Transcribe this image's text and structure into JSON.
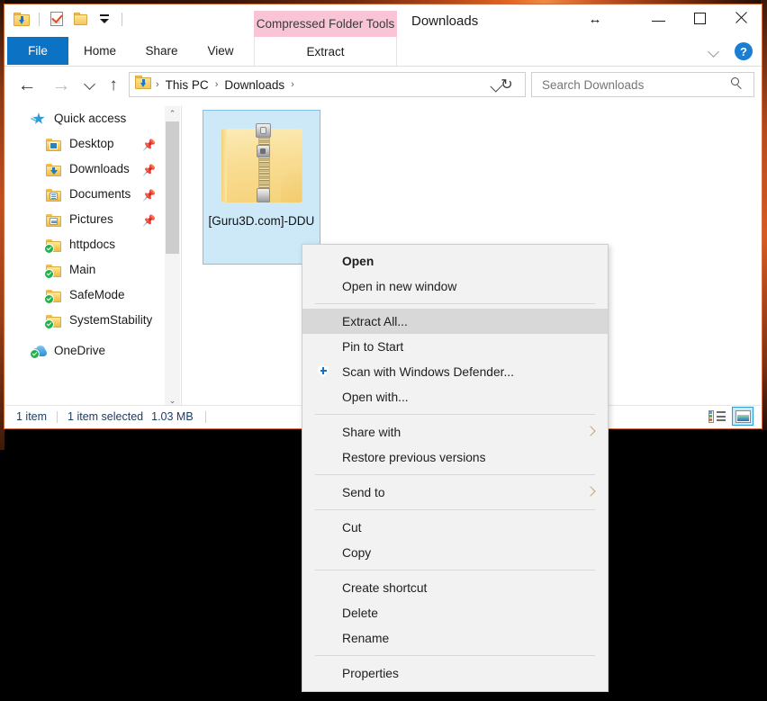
{
  "window": {
    "title": "Downloads",
    "contextual_tab_header": "Compressed Folder Tools",
    "resize_cursor_glyph": "↔",
    "controls": {
      "minimize": "minimize-button",
      "maximize": "maximize-button",
      "close": "close-button",
      "help": "?"
    }
  },
  "quick_access_toolbar": {
    "items": [
      {
        "icon": "downloads-folder-icon"
      },
      {
        "icon": "properties-checkmark-icon"
      },
      {
        "icon": "new-folder-icon"
      },
      {
        "icon": "customize-dropdown-icon"
      }
    ]
  },
  "ribbon": {
    "tabs": [
      {
        "label": "File",
        "selected": true
      },
      {
        "label": "Home",
        "selected": false
      },
      {
        "label": "Share",
        "selected": false
      },
      {
        "label": "View",
        "selected": false
      }
    ],
    "contextual_tab": {
      "label": "Extract",
      "selected": false
    }
  },
  "addressbar": {
    "back_glyph": "←",
    "forward_glyph": "→",
    "up_glyph": "↑",
    "refresh_glyph": "↻",
    "breadcrumb": [
      "This PC",
      "Downloads"
    ],
    "separator": "›"
  },
  "search": {
    "placeholder": "Search Downloads",
    "value": ""
  },
  "navigation_pane": {
    "items": [
      {
        "label": "Quick access",
        "icon": "star-icon",
        "level": "root",
        "pinned": false
      },
      {
        "label": "Desktop",
        "icon": "desktop-folder-icon",
        "level": "child",
        "pinned": true
      },
      {
        "label": "Downloads",
        "icon": "downloads-folder-icon",
        "level": "child",
        "pinned": true
      },
      {
        "label": "Documents",
        "icon": "documents-folder-icon",
        "level": "child",
        "pinned": true
      },
      {
        "label": "Pictures",
        "icon": "pictures-folder-icon",
        "level": "child",
        "pinned": true
      },
      {
        "label": "httpdocs",
        "icon": "synced-folder-icon",
        "level": "child",
        "pinned": false
      },
      {
        "label": "Main",
        "icon": "synced-folder-icon",
        "level": "child",
        "pinned": false
      },
      {
        "label": "SafeMode",
        "icon": "synced-folder-icon",
        "level": "child",
        "pinned": false
      },
      {
        "label": "SystemStability",
        "icon": "synced-folder-icon",
        "level": "child",
        "pinned": false
      },
      {
        "label": "OneDrive",
        "icon": "onedrive-cloud-icon",
        "level": "root",
        "pinned": false
      }
    ],
    "scroll_up_glyph": "⌃",
    "scroll_down_glyph": "⌄"
  },
  "files": [
    {
      "name": "[Guru3D.com]-DDU",
      "icon": "zip-folder-icon",
      "selected": true
    }
  ],
  "statusbar": {
    "item_count": "1 item",
    "selection": "1 item selected",
    "size": "1.03 MB",
    "views": [
      {
        "name": "details-view",
        "selected": false
      },
      {
        "name": "large-icons-view",
        "selected": true
      }
    ]
  },
  "context_menu": {
    "groups": [
      {
        "items": [
          {
            "label": "Open",
            "bold": true,
            "highlighted": false,
            "icon": null,
            "submenu": false
          },
          {
            "label": "Open in new window",
            "bold": false,
            "highlighted": false,
            "icon": null,
            "submenu": false
          }
        ]
      },
      {
        "items": [
          {
            "label": "Extract All...",
            "bold": false,
            "highlighted": true,
            "icon": null,
            "submenu": false
          },
          {
            "label": "Pin to Start",
            "bold": false,
            "highlighted": false,
            "icon": null,
            "submenu": false
          },
          {
            "label": "Scan with Windows Defender...",
            "bold": false,
            "highlighted": false,
            "icon": "defender-shield-icon",
            "submenu": false
          },
          {
            "label": "Open with...",
            "bold": false,
            "highlighted": false,
            "icon": null,
            "submenu": false
          }
        ]
      },
      {
        "items": [
          {
            "label": "Share with",
            "bold": false,
            "highlighted": false,
            "icon": null,
            "submenu": true
          },
          {
            "label": "Restore previous versions",
            "bold": false,
            "highlighted": false,
            "icon": null,
            "submenu": false
          }
        ]
      },
      {
        "items": [
          {
            "label": "Send to",
            "bold": false,
            "highlighted": false,
            "icon": null,
            "submenu": true
          }
        ]
      },
      {
        "items": [
          {
            "label": "Cut",
            "bold": false,
            "highlighted": false,
            "icon": null,
            "submenu": false
          },
          {
            "label": "Copy",
            "bold": false,
            "highlighted": false,
            "icon": null,
            "submenu": false
          }
        ]
      },
      {
        "items": [
          {
            "label": "Create shortcut",
            "bold": false,
            "highlighted": false,
            "icon": null,
            "submenu": false
          },
          {
            "label": "Delete",
            "bold": false,
            "highlighted": false,
            "icon": null,
            "submenu": false
          },
          {
            "label": "Rename",
            "bold": false,
            "highlighted": false,
            "icon": null,
            "submenu": false
          }
        ]
      },
      {
        "items": [
          {
            "label": "Properties",
            "bold": false,
            "highlighted": false,
            "icon": null,
            "submenu": false
          }
        ]
      }
    ]
  },
  "colors": {
    "accent_blue": "#0b72c4",
    "contextual_pink": "#fac4d7",
    "selection_blue": "#cde8f7",
    "menu_bg": "#f2f2f2",
    "menu_highlight": "#d8d8d8"
  }
}
